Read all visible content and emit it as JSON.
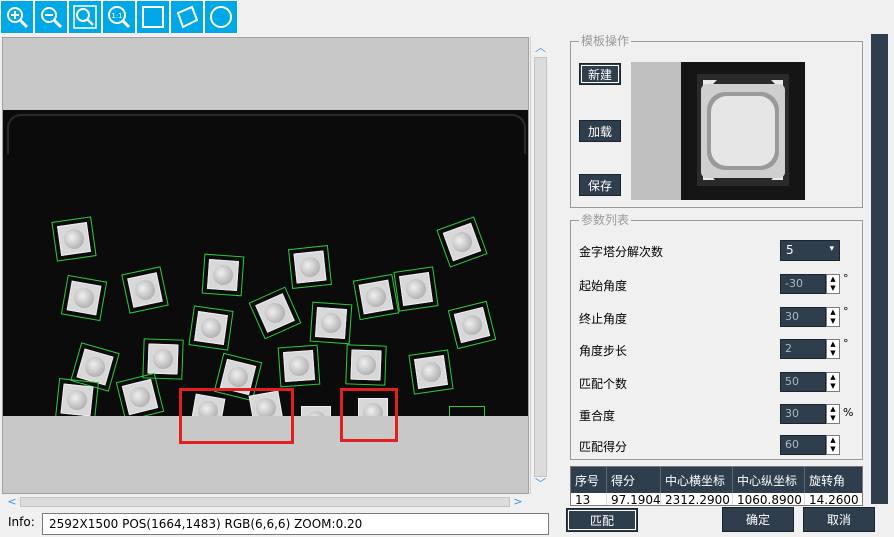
{
  "toolbar": {
    "tools": [
      {
        "icon": "zoom-in-icon"
      },
      {
        "icon": "zoom-out-icon"
      },
      {
        "icon": "zoom-fit-icon"
      },
      {
        "icon": "zoom-actual-icon",
        "label": "1:1"
      },
      {
        "icon": "rectangle-icon"
      },
      {
        "icon": "rotated-rectangle-icon"
      },
      {
        "icon": "circle-icon"
      }
    ]
  },
  "info": {
    "label": "Info:",
    "text": "2592X1500   POS(1664,1483)  RGB(6,6,6)  ZOOM:0.20"
  },
  "template_group": {
    "title": "模板操作",
    "new_label": "新建",
    "load_label": "加载",
    "save_label": "保存"
  },
  "params_group": {
    "title": "参数列表",
    "pyramid_label": "金字塔分解次数",
    "pyramid_value": "5",
    "start_angle_label": "起始角度",
    "start_angle_value": "-30",
    "start_angle_unit": "°",
    "end_angle_label": "终止角度",
    "end_angle_value": "30",
    "end_angle_unit": "°",
    "angle_step_label": "角度步长",
    "angle_step_value": "2",
    "angle_step_unit": "°",
    "match_count_label": "匹配个数",
    "match_count_value": "50",
    "overlap_label": "重合度",
    "overlap_value": "30",
    "overlap_unit": "%",
    "score_label": "匹配得分",
    "score_value": "60"
  },
  "results_table": {
    "headers": [
      "序号",
      "得分",
      "中心横坐标",
      "中心纵坐标",
      "旋转角"
    ],
    "rows": [
      [
        "13",
        "97.1904",
        "2312.2900",
        "1060.8900",
        "14.2600"
      ]
    ]
  },
  "actions": {
    "match_label": "匹配",
    "ok_label": "确定",
    "cancel_label": "取消"
  },
  "colors": {
    "toolbar_blue": "#00a8e8",
    "button_dark": "#2f3e4c",
    "match_green": "#2ecc40",
    "highlight_red": "#e02020"
  }
}
